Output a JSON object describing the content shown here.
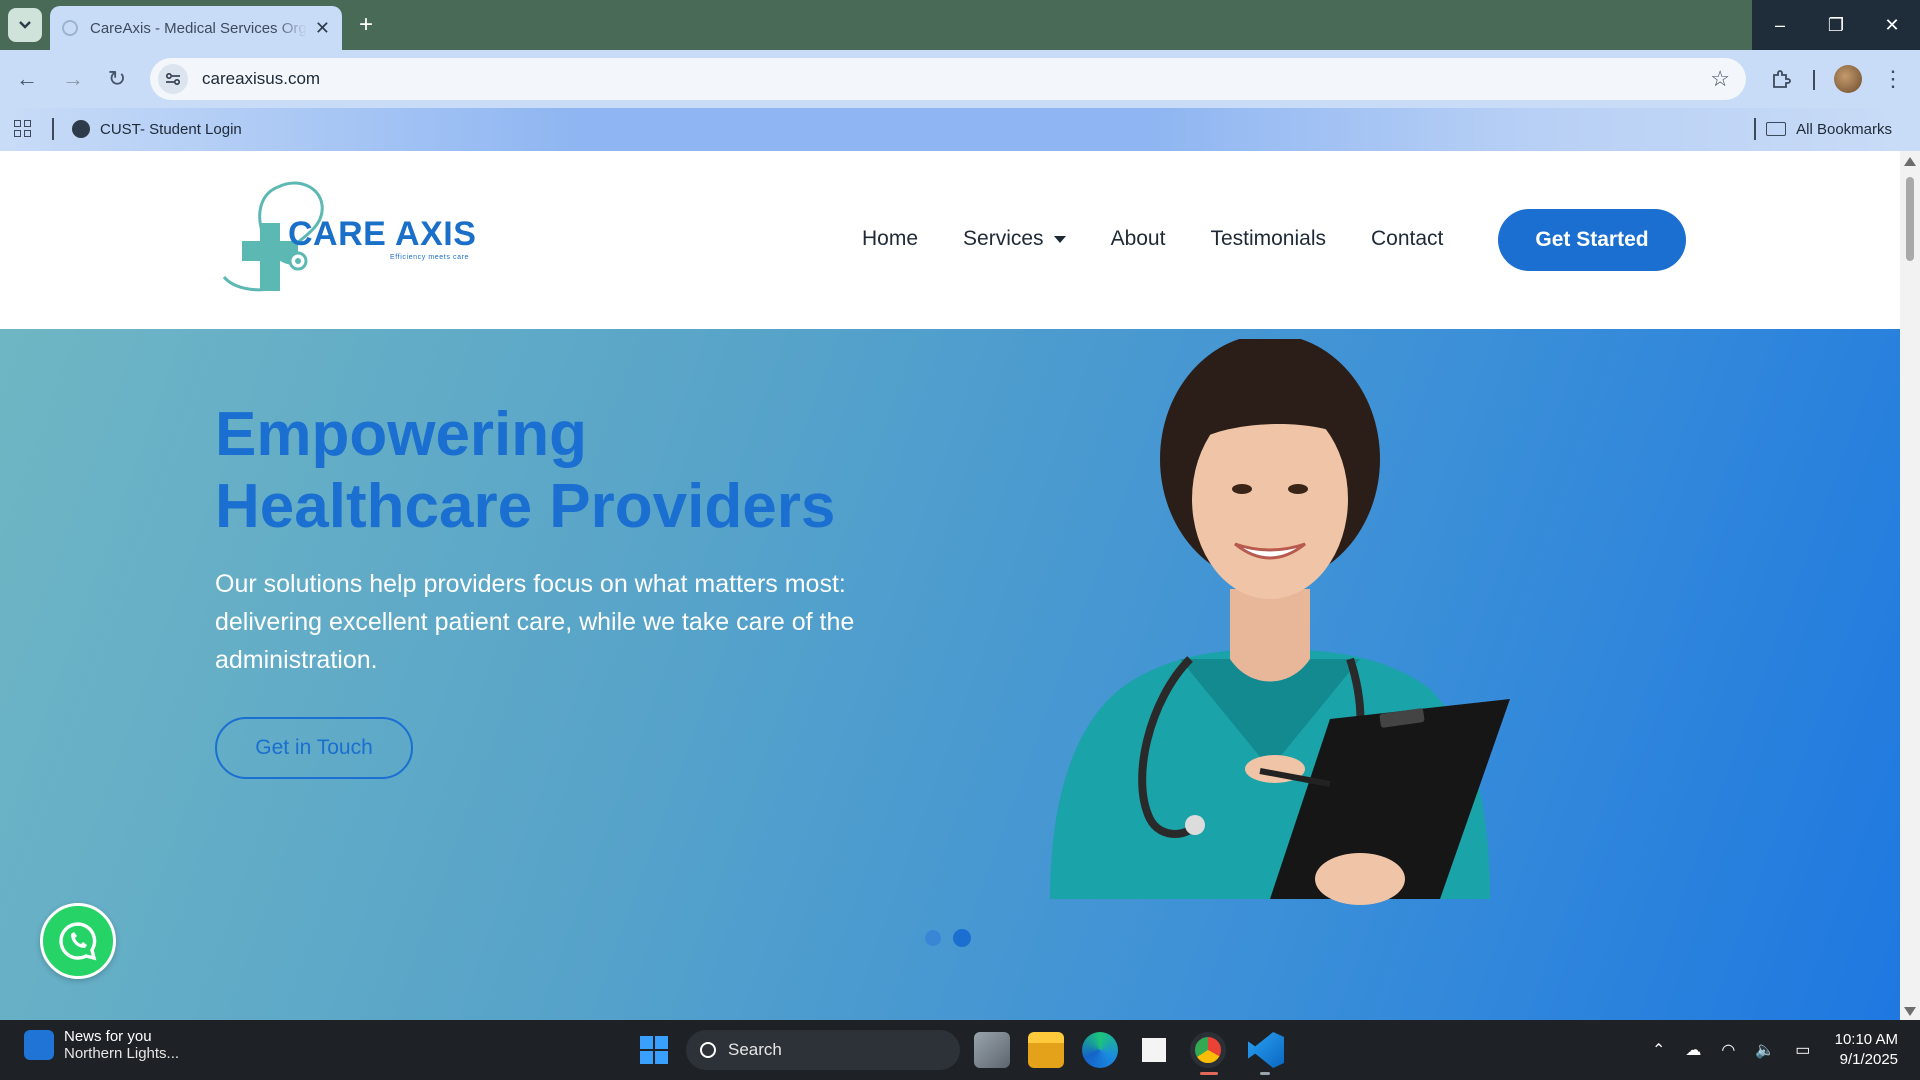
{
  "browser": {
    "tab_title": "CareAxis - Medical Services Organization",
    "url": "careaxisus.com",
    "bookmark_1": "CUST- Student Login",
    "all_bookmarks": "All Bookmarks"
  },
  "site": {
    "logo_name": "CARE AXIS",
    "logo_tagline": "Efficiency meets care",
    "nav": [
      "Home",
      "Services",
      "About",
      "Testimonials",
      "Contact"
    ],
    "cta": "Get Started",
    "brand_color": "#1a6fd0"
  },
  "hero": {
    "title_line1": "Empowering",
    "title_line2": "Healthcare Providers",
    "subtitle": "Our solutions help providers focus on what matters most: delivering excellent patient care, while we take care of the administration.",
    "button": "Get in Touch",
    "carousel_slides": 2,
    "carousel_active": 2
  },
  "taskbar": {
    "news_title": "News for you",
    "news_subtitle": "Northern Lights...",
    "search_label": "Search",
    "time": "10:10 AM",
    "date": "9/1/2025"
  }
}
